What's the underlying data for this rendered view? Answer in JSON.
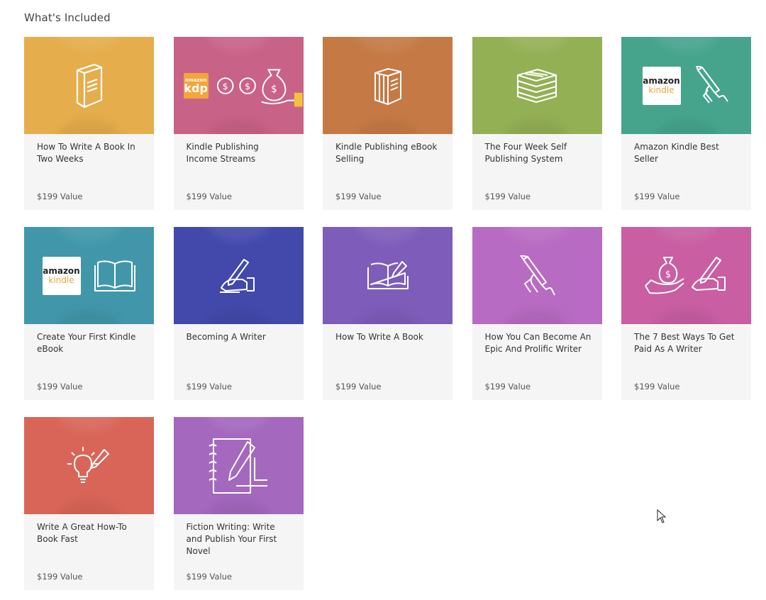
{
  "section": {
    "title": "What's Included"
  },
  "courses": [
    {
      "title": "How To Write A Book In Two Weeks",
      "value": "$199 Value",
      "color": "#e5ad4b",
      "icon": "book-icon"
    },
    {
      "title": "Kindle Publishing Income Streams",
      "value": "$199 Value",
      "color": "#c96287",
      "icon": "kdp-money-bag-icon",
      "brand": {
        "top": "amazon",
        "bottom": "kdp"
      }
    },
    {
      "title": "Kindle Publishing eBook Selling",
      "value": "$199 Value",
      "color": "#c57a45",
      "icon": "books-stack-icon"
    },
    {
      "title": "The Four Week Self Publishing System",
      "value": "$199 Value",
      "color": "#94b055",
      "icon": "book-pile-icon"
    },
    {
      "title": "Amazon Kindle Best Seller",
      "value": "$199 Value",
      "color": "#46a48d",
      "icon": "hand-pen-icon",
      "brand": {
        "top": "amazon",
        "bottom": "kindle"
      }
    },
    {
      "title": "Create Your First Kindle eBook",
      "value": "$199 Value",
      "color": "#4197a9",
      "icon": "open-book-icon",
      "brand": {
        "top": "amazon",
        "bottom": "kindle"
      }
    },
    {
      "title": "Becoming A Writer",
      "value": "$199 Value",
      "color": "#4349ab",
      "icon": "writing-hand-icon"
    },
    {
      "title": "How To Write A Book",
      "value": "$199 Value",
      "color": "#7e5dba",
      "icon": "open-book-pen-icon"
    },
    {
      "title": "How You Can Become An Epic And Prolific Writer",
      "value": "$199 Value",
      "color": "#b86bc2",
      "icon": "hand-pen-icon"
    },
    {
      "title": "The 7 Best Ways To Get Paid As A Writer",
      "value": "$199 Value",
      "color": "#c95ea3",
      "icon": "money-hand-writing-icon"
    },
    {
      "title": "Write A Great How-To Book Fast",
      "value": "$199 Value",
      "color": "#d96558",
      "icon": "lightbulb-pencil-icon"
    },
    {
      "title": "Fiction Writing: Write and Publish Your First Novel",
      "value": "$199 Value",
      "color": "#a468bf",
      "icon": "notebook-pencil-icon"
    }
  ]
}
